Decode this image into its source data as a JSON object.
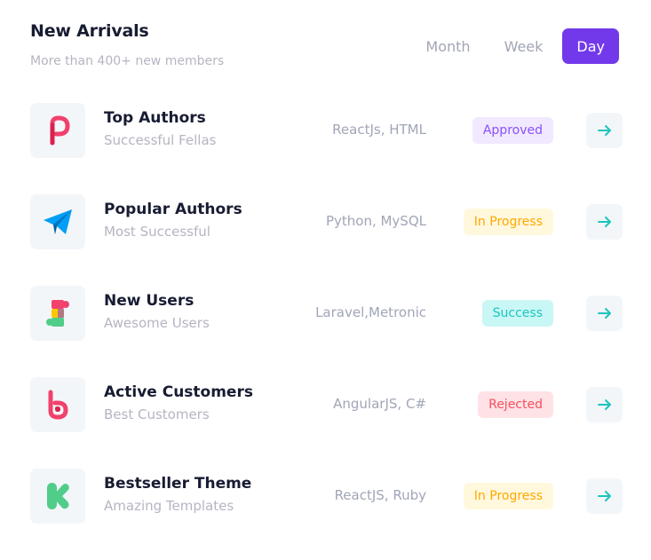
{
  "header": {
    "title": "New Arrivals",
    "subtitle": "More than 400+ new members"
  },
  "tabs": [
    {
      "label": "Month",
      "active": false
    },
    {
      "label": "Week",
      "active": false
    },
    {
      "label": "Day",
      "active": true
    }
  ],
  "colors": {
    "accent": "#7239ea",
    "arrow": "#1bc5bd"
  },
  "rows": [
    {
      "name": "Top Authors",
      "desc": "Successful Fellas",
      "tech": "ReactJs, HTML",
      "status": "Approved",
      "status_bg": "#f1e9ff",
      "status_fg": "#8950fc",
      "icon": "plurk-logo-icon"
    },
    {
      "name": "Popular Authors",
      "desc": "Most Successful",
      "tech": "Python, MySQL",
      "status": "In Progress",
      "status_bg": "#fff8dd",
      "status_fg": "#ffa800",
      "icon": "telegram-logo-icon"
    },
    {
      "name": "New Users",
      "desc": "Awesome Users",
      "tech": "Laravel,Metronic",
      "status": "Success",
      "status_bg": "#c9f7f5",
      "status_fg": "#1bc5bd",
      "icon": "puzzle-logo-icon"
    },
    {
      "name": "Active Customers",
      "desc": "Best Customers",
      "tech": "AngularJS, C#",
      "status": "Rejected",
      "status_bg": "#ffe2e5",
      "status_fg": "#f64e60",
      "icon": "bebo-logo-icon"
    },
    {
      "name": "Bestseller Theme",
      "desc": "Amazing Templates",
      "tech": "ReactJS, Ruby",
      "status": "In Progress",
      "status_bg": "#fff8dd",
      "status_fg": "#ffa800",
      "icon": "kickstarter-logo-icon"
    }
  ]
}
